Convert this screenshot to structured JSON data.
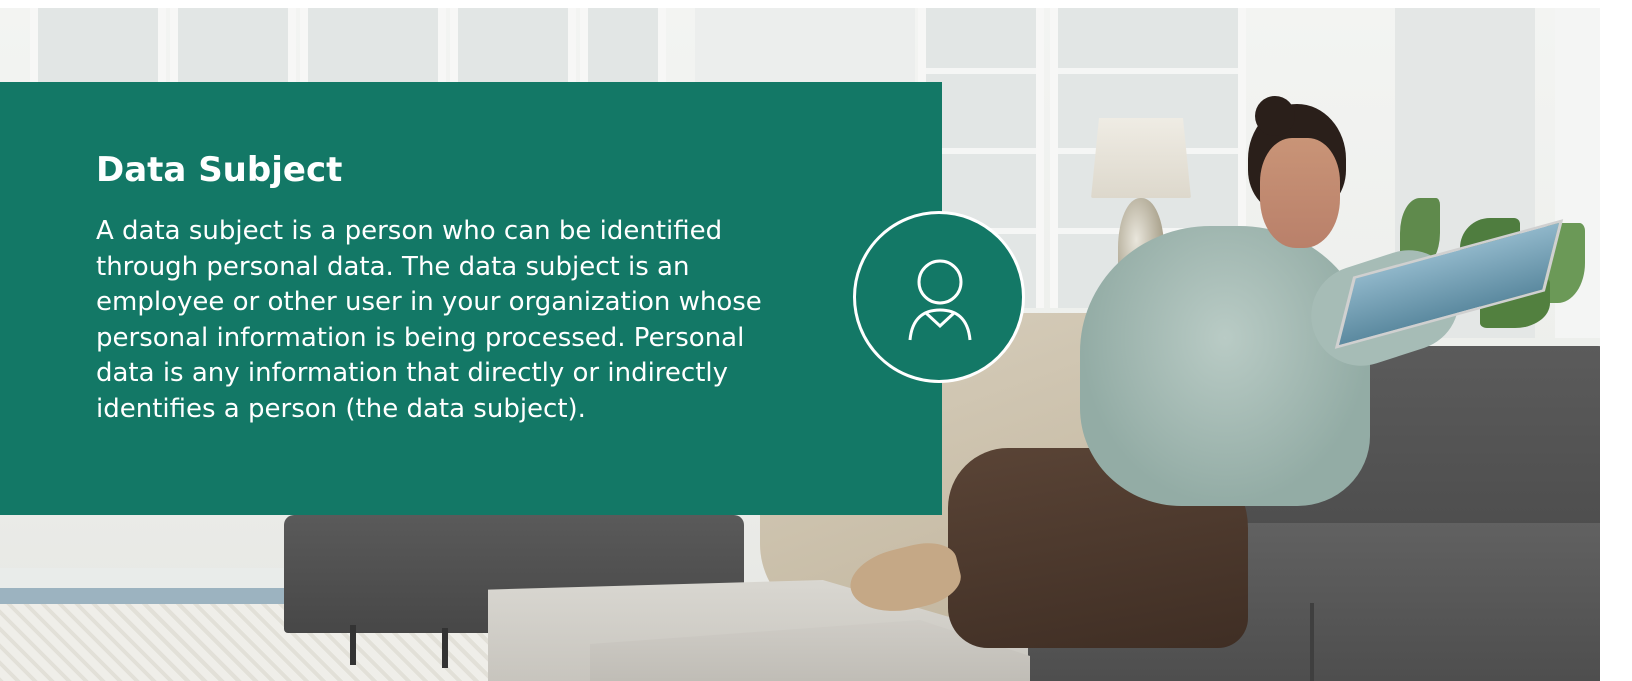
{
  "card": {
    "title": "Data Subject",
    "body": "A data subject is a person who can be identified through personal data. The data subject is an employee or other user in your organization whose personal information is being processed. Personal data is any information that directly or indirectly identifies a person (the data subject)."
  },
  "badge": {
    "icon": "person-icon"
  },
  "colors": {
    "panel": "#137866",
    "text": "#ffffff"
  }
}
